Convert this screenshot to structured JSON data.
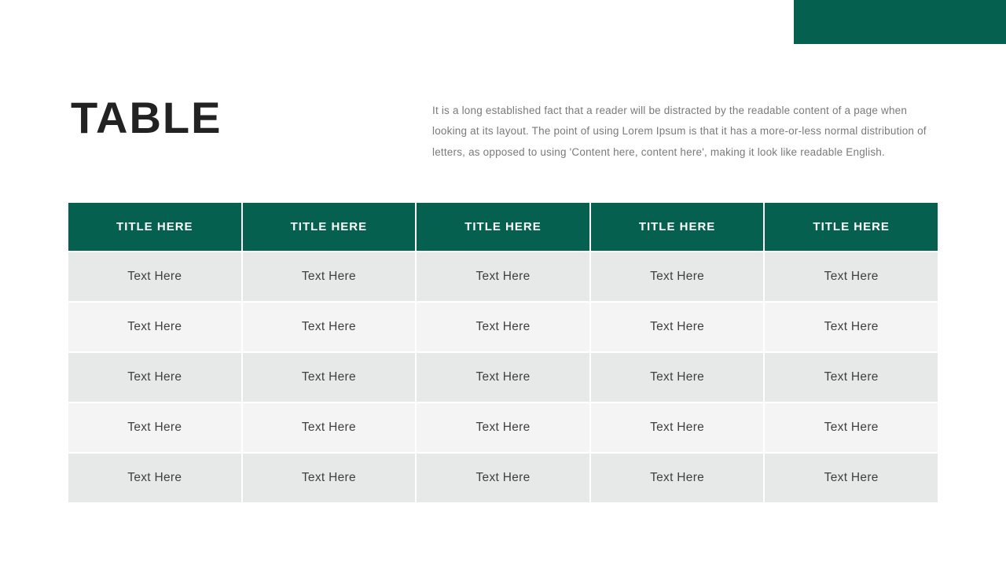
{
  "title": "TABLE",
  "description": "It is a long established fact that a reader will be distracted by the readable content of a page when looking at its layout. The point of using Lorem Ipsum is that it has a more-or-less normal distribution of letters, as opposed to using 'Content here, content here', making it look like readable English.",
  "colors": {
    "accent": "#05604f",
    "row_odd": "#e7e9e8",
    "row_even": "#f3f4f3"
  },
  "table": {
    "headers": [
      "TITLE HERE",
      "TITLE HERE",
      "TITLE HERE",
      "TITLE HERE",
      "TITLE HERE"
    ],
    "rows": [
      [
        "Text Here",
        "Text Here",
        "Text Here",
        "Text Here",
        "Text Here"
      ],
      [
        "Text Here",
        "Text Here",
        "Text Here",
        "Text Here",
        "Text Here"
      ],
      [
        "Text Here",
        "Text Here",
        "Text Here",
        "Text Here",
        "Text Here"
      ],
      [
        "Text Here",
        "Text Here",
        "Text Here",
        "Text Here",
        "Text Here"
      ],
      [
        "Text Here",
        "Text Here",
        "Text Here",
        "Text Here",
        "Text Here"
      ]
    ]
  }
}
